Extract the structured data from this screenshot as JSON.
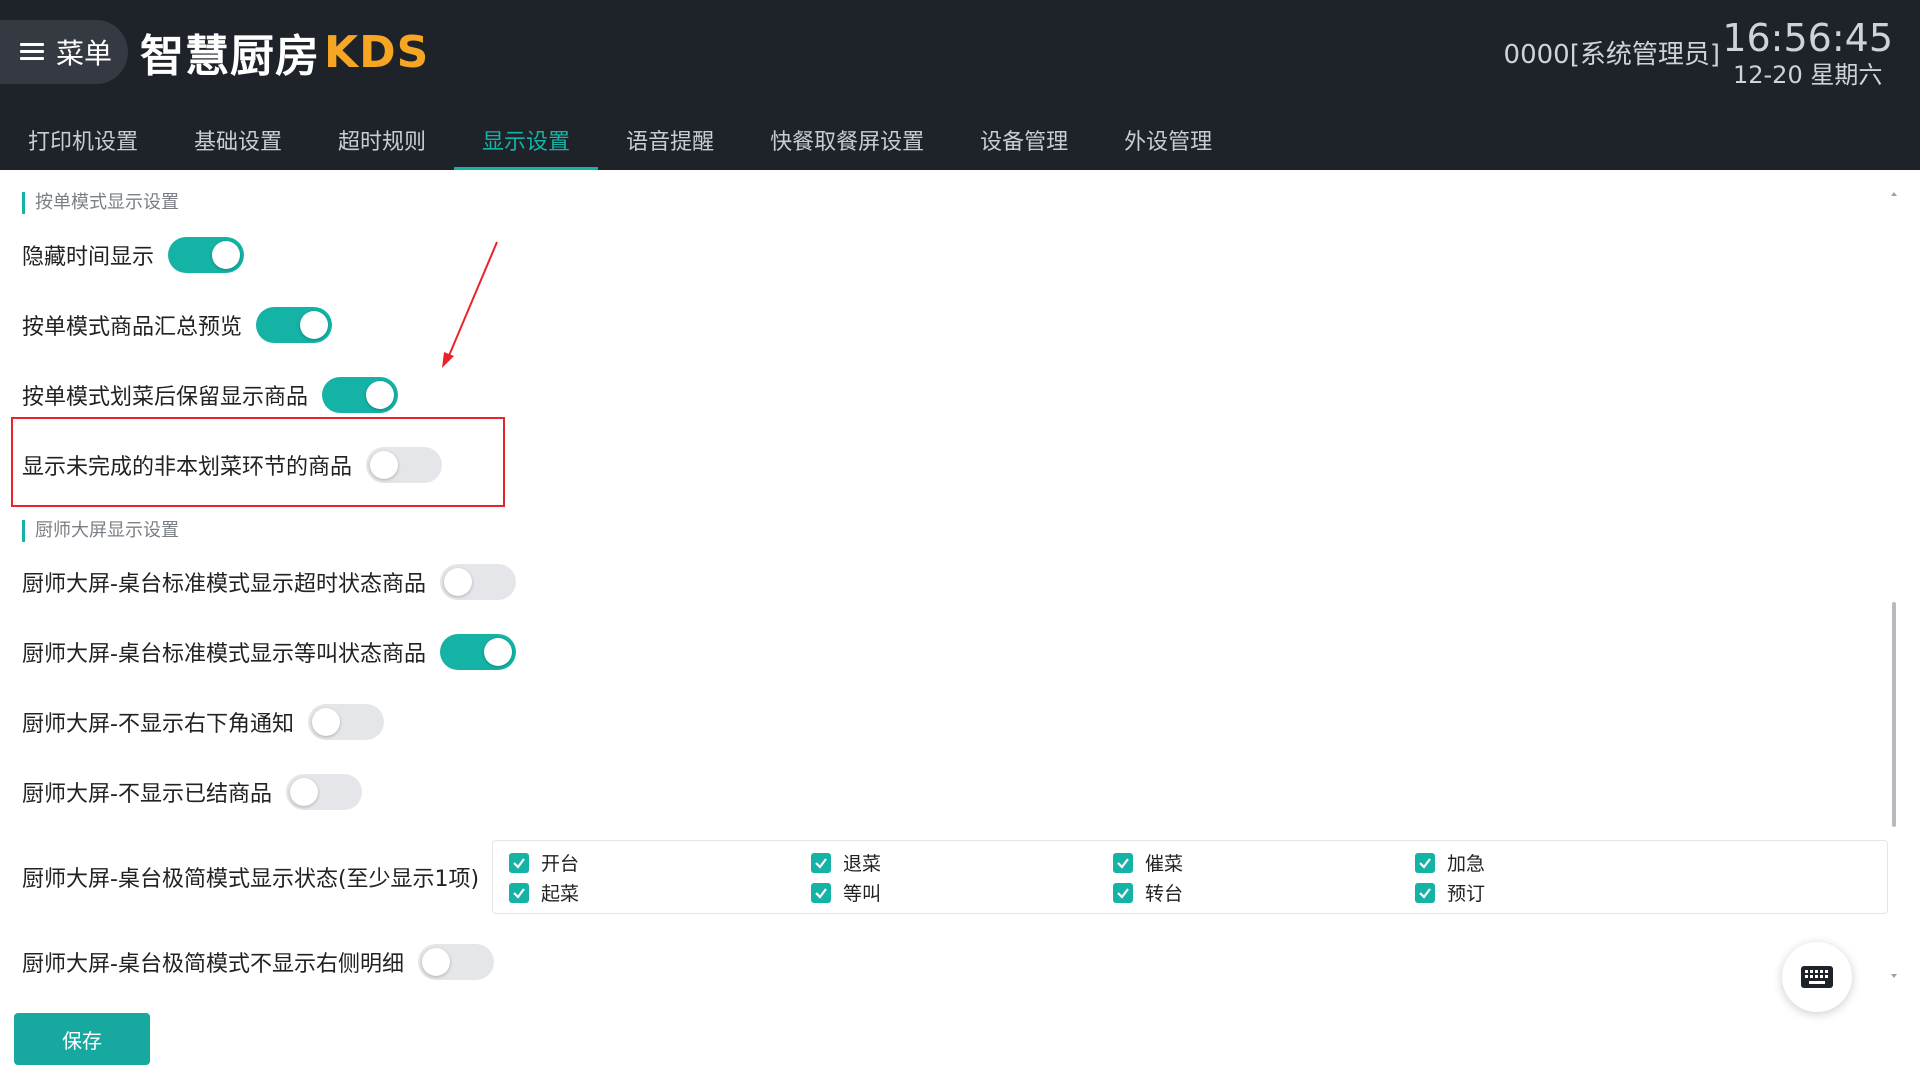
{
  "header": {
    "menu_label": "菜单",
    "brand_cn": "智慧厨房",
    "brand_kds": "KDS",
    "user": "0000[系统管理员]",
    "time": "16:56:45",
    "date": "12-20 星期六"
  },
  "tabs": [
    {
      "label": "打印机设置",
      "active": false
    },
    {
      "label": "基础设置",
      "active": false
    },
    {
      "label": "超时规则",
      "active": false
    },
    {
      "label": "显示设置",
      "active": true
    },
    {
      "label": "语音提醒",
      "active": false
    },
    {
      "label": "快餐取餐屏设置",
      "active": false
    },
    {
      "label": "设备管理",
      "active": false
    },
    {
      "label": "外设管理",
      "active": false
    }
  ],
  "sections": {
    "order_mode": "按单模式显示设置",
    "chef_screen": "厨师大屏显示设置"
  },
  "settings": [
    {
      "label": "隐藏时间显示",
      "on": true
    },
    {
      "label": "按单模式商品汇总预览",
      "on": true
    },
    {
      "label": "按单模式划菜后保留显示商品",
      "on": true
    },
    {
      "label": "显示未完成的非本划菜环节的商品",
      "on": false
    },
    {
      "label": "厨师大屏-桌台标准模式显示超时状态商品",
      "on": false
    },
    {
      "label": "厨师大屏-桌台标准模式显示等叫状态商品",
      "on": true
    },
    {
      "label": "厨师大屏-不显示右下角通知",
      "on": false
    },
    {
      "label": "厨师大屏-不显示已结商品",
      "on": false
    },
    {
      "label": "厨师大屏-桌台极简模式显示状态(至少显示1项)"
    },
    {
      "label": "厨师大屏-桌台极简模式不显示右侧明细",
      "on": false
    }
  ],
  "status_options": [
    {
      "label": "开台",
      "checked": true
    },
    {
      "label": "退菜",
      "checked": true
    },
    {
      "label": "催菜",
      "checked": true
    },
    {
      "label": "加急",
      "checked": true
    },
    {
      "label": "起菜",
      "checked": true
    },
    {
      "label": "等叫",
      "checked": true
    },
    {
      "label": "转台",
      "checked": true
    },
    {
      "label": "预订",
      "checked": true
    }
  ],
  "save_label": "保存",
  "colors": {
    "accent": "#14b3a6",
    "header_bg": "#1e2229",
    "brand_kds": "#f6a623",
    "annotation_red": "#e8242a"
  },
  "icons": {
    "menu": "hamburger-icon",
    "keyboard": "keyboard-icon",
    "checkbox": "check-icon"
  }
}
